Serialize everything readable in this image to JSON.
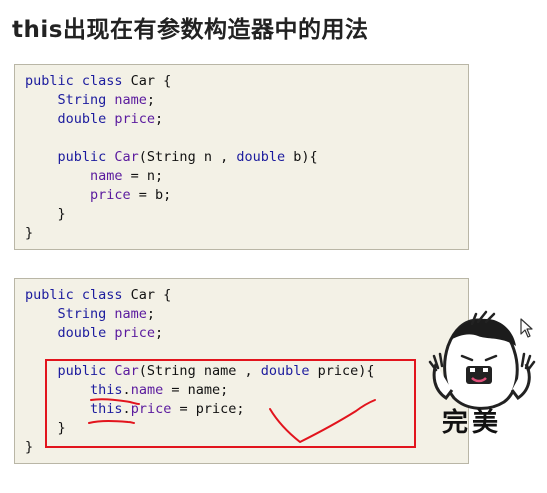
{
  "title": "this出现在有参数构造器中的用法",
  "code_before": {
    "lines": [
      [
        "public class",
        " Car {"
      ],
      [
        "    String ",
        "name",
        ";"
      ],
      [
        "    double ",
        "price",
        ";"
      ],
      [
        ""
      ],
      [
        "    public ",
        "Car",
        "(String n , ",
        "double",
        " b){"
      ],
      [
        "        ",
        "name",
        " = n;"
      ],
      [
        "        ",
        "price",
        " = b;"
      ],
      [
        "    }"
      ],
      [
        "}"
      ]
    ]
  },
  "code_after": {
    "lines": [
      [
        "public class",
        " Car {"
      ],
      [
        "    String ",
        "name",
        ";"
      ],
      [
        "    double ",
        "price",
        ";"
      ],
      [
        ""
      ],
      [
        "    public ",
        "Car",
        "(String name , ",
        "double",
        " price){"
      ],
      [
        "        ",
        "this",
        ".",
        "name",
        " = name;"
      ],
      [
        "        ",
        "this",
        ".",
        "price",
        " = price;"
      ],
      [
        "    }"
      ],
      [
        "}"
      ]
    ]
  },
  "sticker": {
    "caption": "完美",
    "icon": "cartoon-face-sticker"
  },
  "annotation_color": "#e2141d",
  "cursor_icon": "mouse-pointer-icon"
}
